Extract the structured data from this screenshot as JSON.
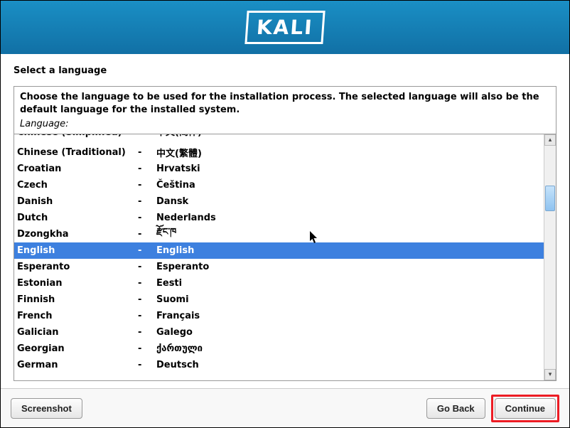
{
  "header": {
    "logo_text": "KALI"
  },
  "page": {
    "title": "Select a language",
    "instructions": "Choose the language to be used for the installation process. The selected language will also be the default language for the installed system.",
    "language_label": "Language:"
  },
  "languages": [
    {
      "name": "Chinese (Simplified)",
      "sep": "-",
      "native": "中文(简体)",
      "cut": true
    },
    {
      "name": "Chinese (Traditional)",
      "sep": "-",
      "native": "中文(繁體)"
    },
    {
      "name": "Croatian",
      "sep": "-",
      "native": "Hrvatski"
    },
    {
      "name": "Czech",
      "sep": "-",
      "native": "Čeština"
    },
    {
      "name": "Danish",
      "sep": "-",
      "native": "Dansk"
    },
    {
      "name": "Dutch",
      "sep": "-",
      "native": "Nederlands"
    },
    {
      "name": "Dzongkha",
      "sep": "-",
      "native": "རྫོང་ཁ"
    },
    {
      "name": "English",
      "sep": "-",
      "native": "English",
      "selected": true
    },
    {
      "name": "Esperanto",
      "sep": "-",
      "native": "Esperanto"
    },
    {
      "name": "Estonian",
      "sep": "-",
      "native": "Eesti"
    },
    {
      "name": "Finnish",
      "sep": "-",
      "native": "Suomi"
    },
    {
      "name": "French",
      "sep": "-",
      "native": "Français"
    },
    {
      "name": "Galician",
      "sep": "-",
      "native": "Galego"
    },
    {
      "name": "Georgian",
      "sep": "-",
      "native": "ქართული"
    },
    {
      "name": "German",
      "sep": "-",
      "native": "Deutsch"
    }
  ],
  "footer": {
    "screenshot": "Screenshot",
    "go_back": "Go Back",
    "continue": "Continue"
  }
}
